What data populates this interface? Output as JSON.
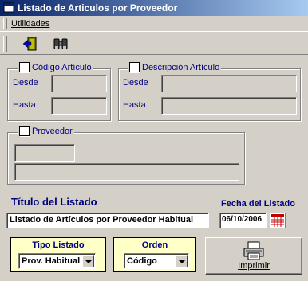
{
  "window": {
    "title": "Listado de Articulos por Proveedor"
  },
  "menu": {
    "items": [
      {
        "label": "Utilidades"
      }
    ]
  },
  "toolbar": {
    "icons": [
      "exit-icon",
      "binoculars-icon"
    ]
  },
  "codigo_group": {
    "legend": "Código Artículo",
    "checked": false,
    "desde_label": "Desde",
    "hasta_label": "Hasta",
    "desde_value": "",
    "hasta_value": ""
  },
  "descripcion_group": {
    "legend": "Descripción Artículo",
    "checked": false,
    "desde_label": "Desde",
    "hasta_label": "Hasta",
    "desde_value": "",
    "hasta_value": ""
  },
  "proveedor_group": {
    "legend": "Proveedor",
    "checked": false,
    "code_value": "",
    "name_value": ""
  },
  "titulo": {
    "label": "Título del Listado",
    "value": "Listado de Artículos por Proveedor Habitual"
  },
  "fecha": {
    "label": "Fecha del Listado",
    "value": "06/10/2006"
  },
  "tipo_listado": {
    "label": "Tipo Listado",
    "selected": "Prov. Habitual"
  },
  "orden": {
    "label": "Orden",
    "selected": "Código"
  },
  "imprimir": {
    "label": "Imprimir"
  },
  "colors": {
    "title_start": "#0a246a",
    "title_end": "#a6caf0",
    "label_blue": "#00007b",
    "panel_yellow": "#ffffc8"
  }
}
